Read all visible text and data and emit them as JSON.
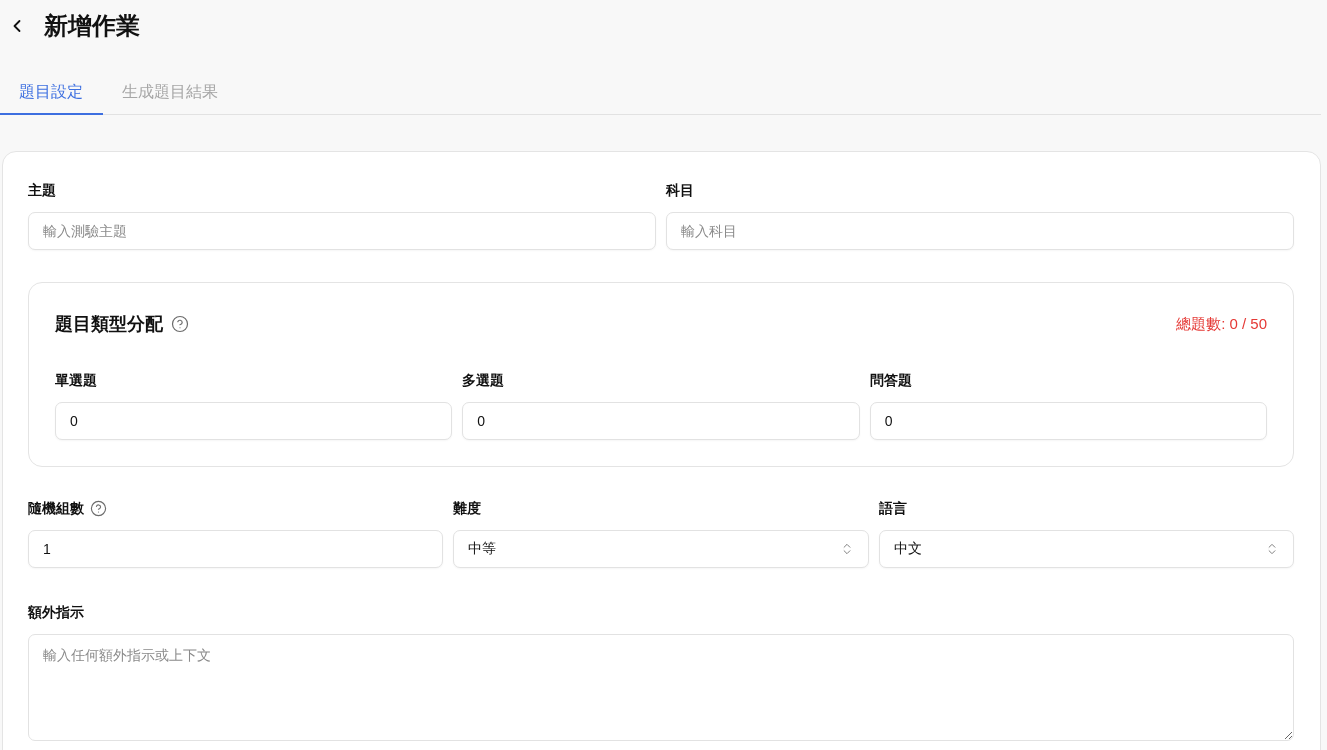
{
  "header": {
    "title": "新增作業"
  },
  "tabs": [
    {
      "label": "題目設定",
      "selected": true
    },
    {
      "label": "生成題目結果",
      "selected": false
    }
  ],
  "form": {
    "top_fields": [
      {
        "label": "主題",
        "placeholder": "輸入測驗主題"
      },
      {
        "label": "科目",
        "placeholder": "輸入科目"
      }
    ],
    "question_types": {
      "title": "題目類型分配",
      "help": true,
      "total": "總題數: 0 / 50",
      "fields": [
        {
          "label": "單選題",
          "value": "0"
        },
        {
          "label": "多選題",
          "value": "0"
        },
        {
          "label": "問答題",
          "value": "0"
        }
      ]
    },
    "settings": [
      {
        "kind": "number",
        "label": "隨機組數",
        "help": true,
        "value": "1"
      },
      {
        "kind": "select",
        "label": "難度",
        "help": false,
        "value": "中等"
      },
      {
        "kind": "select",
        "label": "語言",
        "help": false,
        "value": "中文"
      }
    ],
    "instructions": {
      "label": "額外指示",
      "placeholder": "輸入任何額外指示或上下文"
    }
  }
}
